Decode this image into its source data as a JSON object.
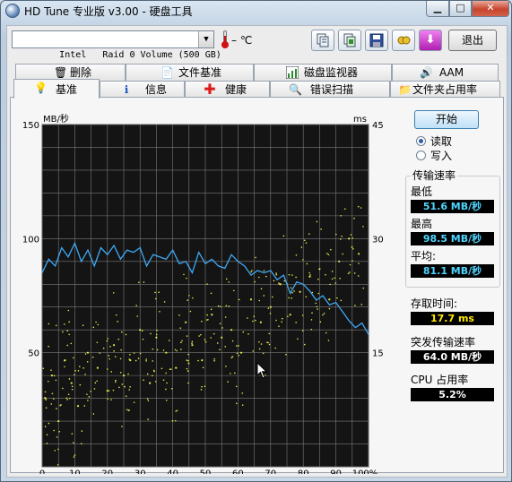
{
  "window": {
    "title": "HD Tune 专业版 v3.00 - 硬盘工具"
  },
  "toolbar": {
    "drive": "Intel   Raid 0 Volume (500 GB)",
    "temperature": "– ℃",
    "buttons": [
      "copy-info-icon",
      "copy-screenshot-icon",
      "save-icon",
      "options-icon",
      "download-icon"
    ],
    "exit_label": "退出"
  },
  "tabs": {
    "row1": [
      {
        "label": "删除",
        "icon": "trash-icon"
      },
      {
        "label": "文件基准",
        "icon": "file-benchmark-icon"
      },
      {
        "label": "磁盘监视器",
        "icon": "monitor-chart-icon"
      },
      {
        "label": "AAM",
        "icon": "speaker-icon"
      }
    ],
    "row2": [
      {
        "label": "基准",
        "icon": "lightbulb-icon",
        "active": true
      },
      {
        "label": "信息",
        "icon": "info-icon"
      },
      {
        "label": "健康",
        "icon": "health-cross-icon"
      },
      {
        "label": "错误扫描",
        "icon": "magnifier-icon"
      },
      {
        "label": "文件夹占用率",
        "icon": "folder-icon"
      }
    ]
  },
  "controls": {
    "start_label": "开始",
    "read_label": "读取",
    "write_label": "写入",
    "selected": "read"
  },
  "stats": {
    "transfer_rate_title": "传输速率",
    "min_label": "最低",
    "min_value": "51.6 MB/秒",
    "max_label": "最高",
    "max_value": "98.5 MB/秒",
    "avg_label": "平均:",
    "avg_value": "81.1 MB/秒",
    "access_label": "存取时间:",
    "access_value": "17.7 ms",
    "burst_label": "突发传输速率",
    "burst_value": "64.0 MB/秒",
    "cpu_label": "CPU 占用率",
    "cpu_value": "5.2%"
  },
  "chart_data": {
    "type": "line",
    "y_left_unit": "MB/秒",
    "y_right_unit": "ms",
    "y_left_ticks": [
      "150",
      "100",
      "50"
    ],
    "y_right_ticks": [
      "45",
      "30",
      "15"
    ],
    "x_ticks": [
      "0",
      "10",
      "20",
      "30",
      "40",
      "50",
      "60",
      "70",
      "80",
      "90",
      "100%"
    ],
    "ylim_left": [
      0,
      150
    ],
    "ylim_right": [
      0,
      45
    ],
    "xlim": [
      0,
      100
    ],
    "grid": true,
    "colors": {
      "background": "#1a1a1a",
      "grid": "#7a7a7a",
      "transfer": "#3fa9f5",
      "access": "#e8e84a"
    },
    "series": [
      {
        "x": [
          0,
          2,
          4,
          6,
          8,
          10,
          12,
          14,
          16,
          18,
          20,
          22,
          24,
          26,
          28,
          30,
          32,
          34,
          36,
          38,
          40,
          42,
          44,
          46,
          48,
          50,
          52,
          54,
          56,
          58,
          60,
          62,
          64,
          66,
          68,
          70,
          72,
          74,
          76,
          78,
          80,
          82,
          84,
          86,
          88,
          90,
          92,
          94,
          96,
          98,
          100
        ],
        "values": [
          85,
          91,
          88,
          96,
          92,
          98,
          90,
          95,
          88,
          96,
          93,
          97,
          91,
          95,
          94,
          96,
          88,
          93,
          92,
          91,
          95,
          89,
          90,
          85,
          94,
          89,
          91,
          88,
          87,
          93,
          90,
          88,
          84,
          86,
          85,
          86,
          82,
          84,
          76,
          81,
          80,
          77,
          73,
          75,
          71,
          72,
          68,
          64,
          61,
          63,
          58
        ]
      },
      {
        "x": [
          1,
          3,
          5,
          7,
          9,
          11,
          14,
          17,
          20,
          22,
          25,
          27,
          30,
          33,
          35,
          38,
          41,
          44,
          46,
          49,
          52,
          55,
          58,
          61,
          64,
          67,
          70,
          73,
          76,
          79,
          82,
          85,
          88,
          91,
          94,
          97
        ],
        "values": [
          9,
          12,
          6,
          14,
          11,
          8,
          15,
          13,
          10,
          16,
          12,
          14,
          18,
          11,
          17,
          15,
          13,
          19,
          16,
          14,
          20,
          17,
          18,
          15,
          22,
          19,
          21,
          24,
          20,
          23,
          25,
          26,
          22,
          27,
          30,
          28
        ]
      }
    ]
  }
}
